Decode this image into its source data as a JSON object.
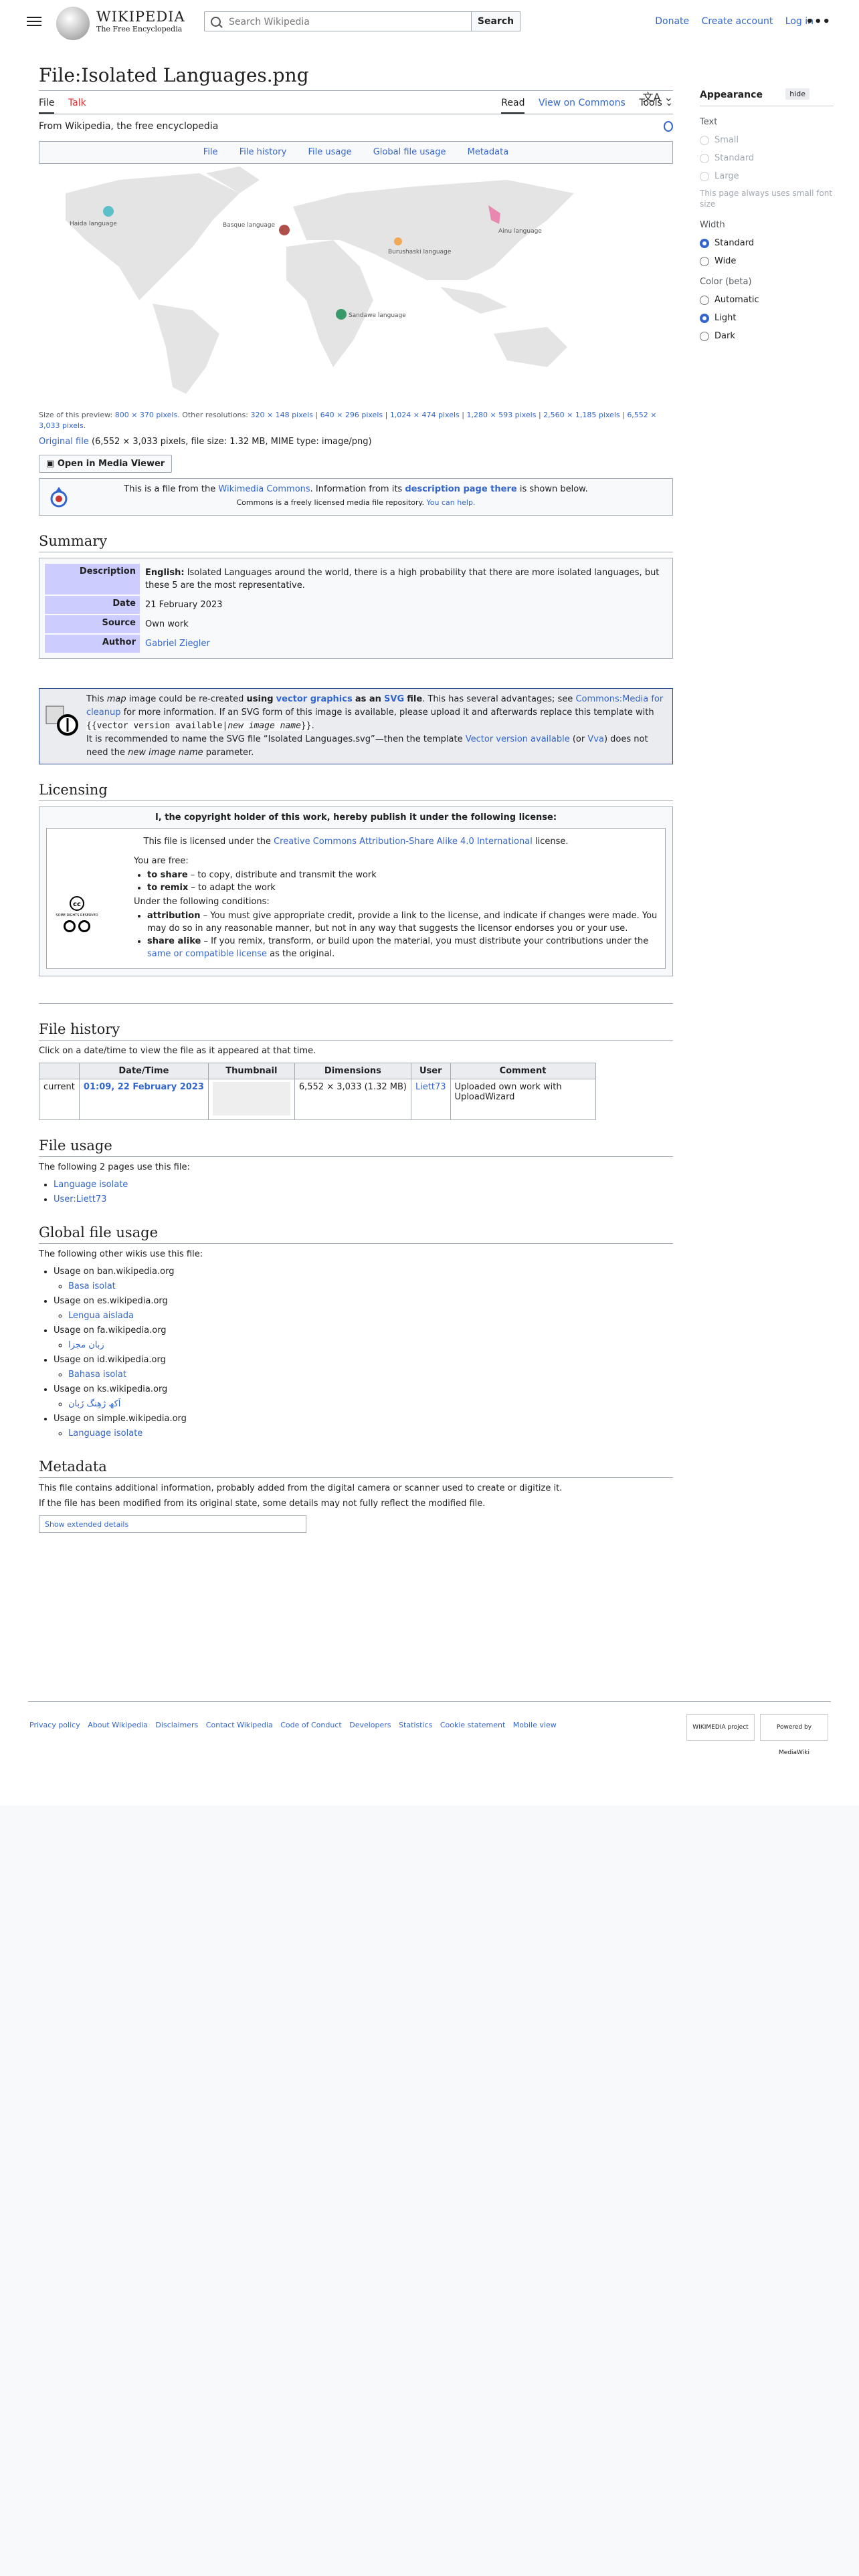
{
  "header": {
    "logo_word": "WIKIPEDIA",
    "logo_tagline": "The Free Encyclopedia",
    "search_placeholder": "Search Wikipedia",
    "search_button": "Search",
    "links": [
      "Donate",
      "Create account",
      "Log in"
    ]
  },
  "page": {
    "title": "File:Isolated Languages.png",
    "tabs_left": [
      "File",
      "Talk"
    ],
    "tabs_right": [
      "Read",
      "View on Commons",
      "Tools"
    ],
    "from_text": "From Wikipedia, the free encyclopedia",
    "file_toc": [
      "File",
      "File history",
      "File usage",
      "Global file usage",
      "Metadata"
    ]
  },
  "map": {
    "labels": [
      "Haida language",
      "Basque language",
      "Burushaski language",
      "Ainu language",
      "Sandawe language"
    ],
    "colors": {
      "haida": "#5bc0c8",
      "basque": "#b0504a",
      "burushaski": "#f0a855",
      "ainu": "#e888b0",
      "sandawe": "#3a9a6a",
      "land": "#e4e4e4"
    }
  },
  "preview": {
    "size_label": "Size of this preview:",
    "size_value": "800 × 370 pixels",
    "other_label": "Other resolutions:",
    "resolutions": [
      "320 × 148 pixels",
      "640 × 296 pixels",
      "1,024 × 474 pixels",
      "1,280 × 593 pixels",
      "2,560 × 1,185 pixels",
      "6,552 × 3,033 pixels"
    ],
    "original_link": "Original file",
    "original_meta": "(6,552 × 3,033 pixels, file size: 1.32 MB, MIME type: image/png)",
    "media_viewer_button": "Open in Media Viewer"
  },
  "commons_box": {
    "line1_a": "This is a file from the",
    "line1_link": "Wikimedia Commons",
    "line1_b": ". Information from its",
    "line1_link2": "description page there",
    "line1_c": "is shown below.",
    "line2_a": "Commons is a freely licensed media file repository.",
    "line2_link": "You can help."
  },
  "summary": {
    "heading": "Summary",
    "rows": [
      {
        "label": "Description",
        "lang": "English:",
        "value": "Isolated Languages around the world, there is a high probability that there are more isolated languages, but these 5 are the most representative."
      },
      {
        "label": "Date",
        "value": "21 February 2023"
      },
      {
        "label": "Source",
        "value": "Own work"
      },
      {
        "label": "Author",
        "value": "Gabriel Ziegler"
      }
    ]
  },
  "svg_notice": {
    "t1": "This",
    "t2": "map",
    "t3": "image could be re-created",
    "t4": "using",
    "t5": "vector graphics",
    "t6": "as an",
    "t7": "SVG",
    "t8": "file",
    "t9": ". This has several advantages; see",
    "link1": "Commons:Media for cleanup",
    "t10": "for more information. If an SVG form of this image is available, please upload it and afterwards replace this template with",
    "code_a": "{{vector version available|",
    "code_b": "new image name",
    "code_c": "}}",
    "t11": ".",
    "t12": "It is recommended to name the SVG file “Isolated Languages.svg”—then the template",
    "link2": "Vector version available",
    "t13": "(or",
    "link3": "Vva",
    "t14": ") does not need the",
    "t15": "new image name",
    "t16": "parameter."
  },
  "licensing": {
    "heading": "Licensing",
    "box_title": "I, the copyright holder of this work, hereby publish it under the following license:",
    "licensed_a": "This file is licensed under the",
    "licensed_link": "Creative Commons Attribution-Share Alike 4.0 International",
    "licensed_b": "license.",
    "cc_text": "SOME RIGHTS RESERVED",
    "free": "You are free:",
    "free_items": [
      {
        "b": "to share",
        "t": " – to copy, distribute and transmit the work"
      },
      {
        "b": "to remix",
        "t": " – to adapt the work"
      }
    ],
    "conditions": "Under the following conditions:",
    "cond_items": [
      {
        "b": "attribution",
        "t": " – You must give appropriate credit, provide a link to the license, and indicate if changes were made. You may do so in any reasonable manner, but not in any way that suggests the licensor endorses you or your use."
      },
      {
        "b": "share alike",
        "t": " – If you remix, transform, or build upon the material, you must distribute your contributions under the ",
        "link": "same or compatible license",
        "t2": " as the original."
      }
    ]
  },
  "history": {
    "heading": "File history",
    "intro": "Click on a date/time to view the file as it appeared at that time.",
    "cols": [
      "Date/Time",
      "Thumbnail",
      "Dimensions",
      "User",
      "Comment"
    ],
    "row": {
      "status": "current",
      "date": "01:09, 22 February 2023",
      "dims": "6,552 × 3,033 (1.32 MB)",
      "user": "Liett73",
      "comment": "Uploaded own work with UploadWizard"
    }
  },
  "usage": {
    "heading": "File usage",
    "intro": "The following 2 pages use this file:",
    "pages": [
      "Language isolate",
      "User:Liett73"
    ]
  },
  "global_usage": {
    "heading": "Global file usage",
    "intro": "The following other wikis use this file:",
    "wikis": [
      {
        "wiki": "Usage on ban.wikipedia.org",
        "page": "Basa isolat"
      },
      {
        "wiki": "Usage on es.wikipedia.org",
        "page": "Lengua aislada"
      },
      {
        "wiki": "Usage on fa.wikipedia.org",
        "page": "زبان مجزا"
      },
      {
        "wiki": "Usage on id.wikipedia.org",
        "page": "Bahasa isolat"
      },
      {
        "wiki": "Usage on ks.wikipedia.org",
        "page": "اَکھ ژھِنگ زَبان"
      },
      {
        "wiki": "Usage on simple.wikipedia.org",
        "page": "Language isolate"
      }
    ]
  },
  "metadata": {
    "heading": "Metadata",
    "p1": "This file contains additional information, probably added from the digital camera or scanner used to create or digitize it.",
    "p2": "If the file has been modified from its original state, some details may not fully reflect the modified file.",
    "button": "Show extended details"
  },
  "footer": {
    "links": [
      "Privacy policy",
      "About Wikipedia",
      "Disclaimers",
      "Contact Wikipedia",
      "Code of Conduct",
      "Developers",
      "Statistics",
      "Cookie statement",
      "Mobile view"
    ],
    "badge1": "WIKIMEDIA project",
    "badge2": "Powered by MediaWiki"
  },
  "sidebar": {
    "title": "Appearance",
    "hide": "hide",
    "text_label": "Text",
    "text_options": [
      "Small",
      "Standard",
      "Large"
    ],
    "note": "This page always uses small font size",
    "width_label": "Width",
    "width_options": [
      "Standard",
      "Wide"
    ],
    "color_label": "Color (beta)",
    "color_options": [
      "Automatic",
      "Light",
      "Dark"
    ]
  }
}
